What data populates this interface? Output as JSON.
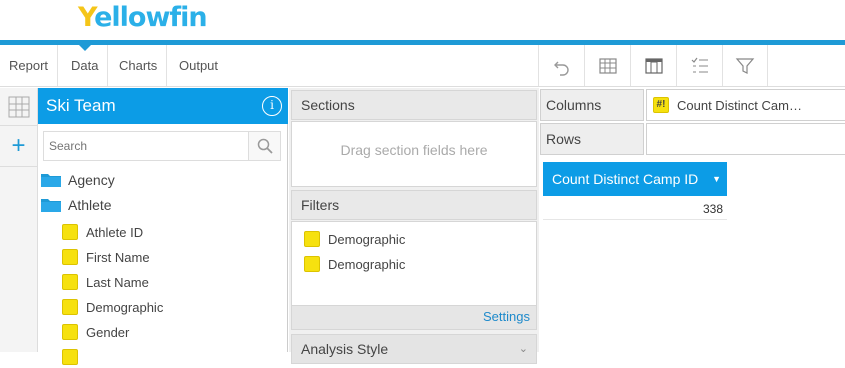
{
  "app": {
    "logo_y": "Y",
    "logo_rest": "ellowfin"
  },
  "nav": {
    "tabs": [
      {
        "label": "Report"
      },
      {
        "label": "Data",
        "active": true
      },
      {
        "label": "Charts"
      },
      {
        "label": "Output"
      }
    ],
    "tools": [
      "undo-icon",
      "table-icon",
      "layout-icon",
      "checklist-icon",
      "filter-icon"
    ]
  },
  "view": {
    "title": "Ski Team",
    "info_glyph": "i"
  },
  "search": {
    "placeholder": "Search"
  },
  "folders": [
    {
      "label": "Agency"
    },
    {
      "label": "Athlete"
    }
  ],
  "fields": [
    {
      "label": "Athlete ID"
    },
    {
      "label": "First Name"
    },
    {
      "label": "Last Name"
    },
    {
      "label": "Demographic"
    },
    {
      "label": "Gender"
    }
  ],
  "sections": {
    "header": "Sections",
    "drop_hint": "Drag section fields here"
  },
  "filters": {
    "header": "Filters",
    "items": [
      {
        "label": "Demographic"
      },
      {
        "label": "Demographic"
      }
    ],
    "settings_label": "Settings"
  },
  "analysis": {
    "header": "Analysis Style"
  },
  "columns": {
    "label": "Columns",
    "field": "Count Distinct Cam…",
    "metric_glyph": "#!"
  },
  "rows": {
    "label": "Rows"
  },
  "table": {
    "column_header": "Count Distinct Camp ID",
    "value": "338"
  },
  "colors": {
    "accent": "#0c9ce6",
    "dimension": "#f6e10f",
    "logo_yellow": "#f5c518"
  }
}
